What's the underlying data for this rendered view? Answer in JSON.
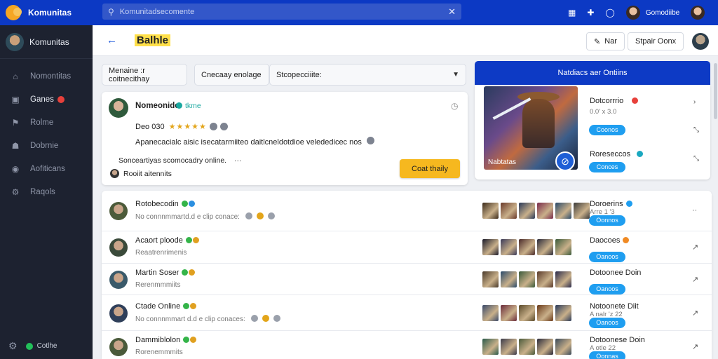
{
  "app": {
    "name": "Komunitas",
    "user_name": "Gomodiibe"
  },
  "search": {
    "placeholder": "Komunitadsecomente"
  },
  "sidebar": {
    "title": "Komunitas",
    "items": [
      {
        "label": "Nomontitas",
        "icon": "home-icon"
      },
      {
        "label": "Ganes",
        "icon": "gamepad-icon",
        "badge": true
      },
      {
        "label": "Rolme",
        "icon": "trophy-icon"
      },
      {
        "label": "Dobrnie",
        "icon": "users-icon"
      },
      {
        "label": "Aofiticans",
        "icon": "bell-icon"
      },
      {
        "label": "Raqols",
        "icon": "settings-icon"
      }
    ],
    "status": "Cotlhe"
  },
  "header": {
    "title": "Balhle",
    "btn_pen": "Nar",
    "btn_share": "Stpair Oonx"
  },
  "filters": {
    "f1": "Menaine :r coitnecithay",
    "f2": "Cnecaay enolage",
    "f3": "Stcopecciiite:"
  },
  "feature": {
    "name": "Nomeonide",
    "tag": "tkme",
    "stats": "Deo 030",
    "desc": "Apanecacialc aisic isecatarmiiteo daitlcneldotdioe velededicec nos",
    "status": "Sonceartiyas scomocadry online.",
    "status_more": "···",
    "user": "Rooiit aitennits",
    "cta": "Coat thaily"
  },
  "panel": {
    "title": "Natdiacs aer Ontiins",
    "game_label": "Nabtatas",
    "entries": [
      {
        "name": "Dotcorrrio",
        "sub": "0.0' x 3.0",
        "action": "Coonos",
        "dot": "#e7403b"
      },
      {
        "name": "Roreseccos",
        "sub": "",
        "action": "Conces",
        "dot": "#1aa8c0"
      }
    ]
  },
  "members": [
    {
      "name": "Rotobecodin",
      "sub": "No connnmmartd.d e clip conace:",
      "right_name": "Doroerins",
      "right_sub": "Arre 1 '3",
      "pill": "Oonnos",
      "dot": "#1f9ef0",
      "action": "··"
    },
    {
      "name": "Acaort ploode",
      "sub": "Reaatrenrimenis",
      "right_name": "Daocoes",
      "right_sub": "",
      "pill": "Oanoos",
      "dot": "#f08a24",
      "action": "↗"
    },
    {
      "name": "Martin Soser",
      "sub": "Rerenmmmiits",
      "right_name": "Dotoonee Doin",
      "right_sub": "",
      "pill": "Oanoos",
      "dot": "",
      "action": "↗"
    },
    {
      "name": "Ctade Online",
      "sub": "No connnmmart d.d e clip conaces:",
      "right_name": "Notoonete Diit",
      "right_sub": "A nalr 'z 22",
      "pill": "Oanoos",
      "dot": "",
      "action": "↗"
    },
    {
      "name": "Dammiblolon",
      "sub": "Rorenemmmits",
      "right_name": "Dotoonese Doin",
      "right_sub": "A otle 22",
      "pill": "Oonnas",
      "dot": "",
      "action": "↗"
    }
  ]
}
